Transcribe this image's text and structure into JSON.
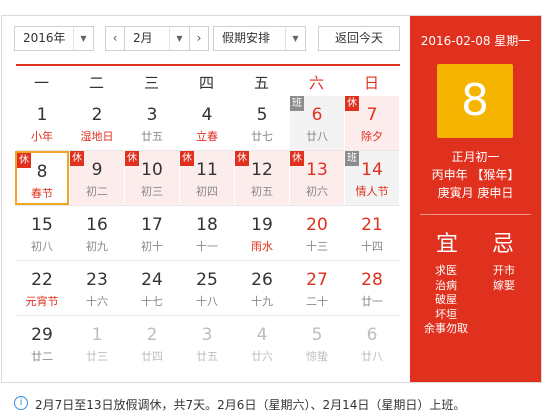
{
  "toolbar": {
    "year": "2016年",
    "month": "2月",
    "holiday_select": "假期安排",
    "prev": "‹",
    "next": "›",
    "today_button": "返回今天"
  },
  "weekdays": [
    "一",
    "二",
    "三",
    "四",
    "五",
    "六",
    "日"
  ],
  "weeks": [
    [
      {
        "day": "1",
        "lunar": "小年",
        "fest": true
      },
      {
        "day": "2",
        "lunar": "湿地日",
        "fest": true
      },
      {
        "day": "3",
        "lunar": "廿五"
      },
      {
        "day": "4",
        "lunar": "立春",
        "fest": true
      },
      {
        "day": "5",
        "lunar": "廿七"
      },
      {
        "day": "6",
        "lunar": "廿八",
        "tag": "班",
        "red": true,
        "work": true
      },
      {
        "day": "7",
        "lunar": "除夕",
        "tag": "休",
        "red": true,
        "fest": true,
        "rest": true
      }
    ],
    [
      {
        "day": "8",
        "lunar": "春节",
        "tag": "休",
        "fest": true,
        "rest": true,
        "today": true
      },
      {
        "day": "9",
        "lunar": "初二",
        "tag": "休",
        "rest": true
      },
      {
        "day": "10",
        "lunar": "初三",
        "tag": "休",
        "rest": true
      },
      {
        "day": "11",
        "lunar": "初四",
        "tag": "休",
        "rest": true
      },
      {
        "day": "12",
        "lunar": "初五",
        "tag": "休",
        "rest": true
      },
      {
        "day": "13",
        "lunar": "初六",
        "tag": "休",
        "red": true,
        "rest": true
      },
      {
        "day": "14",
        "lunar": "情人节",
        "tag": "班",
        "red": true,
        "fest": true,
        "work": true
      }
    ],
    [
      {
        "day": "15",
        "lunar": "初八"
      },
      {
        "day": "16",
        "lunar": "初九"
      },
      {
        "day": "17",
        "lunar": "初十"
      },
      {
        "day": "18",
        "lunar": "十一"
      },
      {
        "day": "19",
        "lunar": "雨水",
        "fest": true
      },
      {
        "day": "20",
        "lunar": "十三",
        "red": true
      },
      {
        "day": "21",
        "lunar": "十四",
        "red": true
      }
    ],
    [
      {
        "day": "22",
        "lunar": "元宵节",
        "fest": true
      },
      {
        "day": "23",
        "lunar": "十六"
      },
      {
        "day": "24",
        "lunar": "十七"
      },
      {
        "day": "25",
        "lunar": "十八"
      },
      {
        "day": "26",
        "lunar": "十九"
      },
      {
        "day": "27",
        "lunar": "二十",
        "red": true
      },
      {
        "day": "28",
        "lunar": "廿一",
        "red": true
      }
    ],
    [
      {
        "day": "29",
        "lunar": "廿二"
      },
      {
        "day": "1",
        "lunar": "廿三",
        "dim": true
      },
      {
        "day": "2",
        "lunar": "廿四",
        "dim": true
      },
      {
        "day": "3",
        "lunar": "廿五",
        "dim": true
      },
      {
        "day": "4",
        "lunar": "廿六",
        "dim": true
      },
      {
        "day": "5",
        "lunar": "惊蛰",
        "dim": true
      },
      {
        "day": "6",
        "lunar": "廿八",
        "dim": true
      }
    ]
  ],
  "panel": {
    "date_line": "2016-02-08 星期一",
    "big_day": "8",
    "lunar_date": "正月初一",
    "ganzhi_year": "丙申年 【猴年】",
    "ganzhi_month_day": "庚寅月 庚申日",
    "yi_label": "宜",
    "ji_label": "忌",
    "yi_items": [
      "求医",
      "治病",
      "破屋",
      "坏垣",
      "余事勿取"
    ],
    "ji_items": [
      "开市",
      "嫁娶"
    ]
  },
  "info": {
    "icon": "info-icon",
    "text": "2月7日至13日放假调休，共7天。2月6日（星期六）、2月14日（星期日）上班。"
  },
  "colors": {
    "accent": "#e0301e",
    "today_box": "#f5b400",
    "today_border": "#f0a523"
  }
}
